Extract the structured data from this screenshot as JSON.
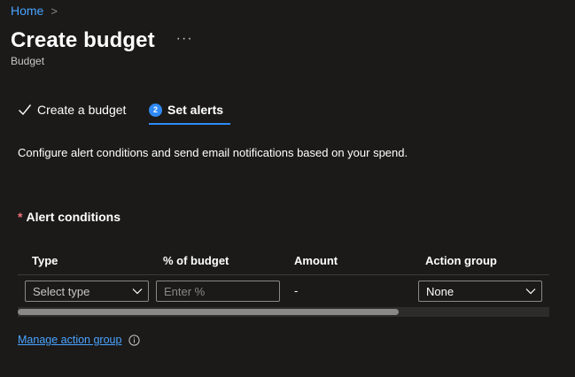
{
  "breadcrumb": {
    "home": "Home",
    "separator": ">"
  },
  "header": {
    "title": "Create budget",
    "more": "···",
    "subtitle": "Budget"
  },
  "steps": [
    {
      "label": "Create a budget",
      "state": "completed",
      "icon": "checkmark-icon"
    },
    {
      "label": "Set alerts",
      "number": "2",
      "state": "active"
    }
  ],
  "description": "Configure alert conditions and send email notifications based on your spend.",
  "alert_conditions": {
    "required_marker": "*",
    "title": "Alert conditions",
    "columns": [
      "Type",
      "% of budget",
      "Amount",
      "Action group"
    ],
    "row": {
      "type_placeholder": "Select type",
      "percent_placeholder": "Enter %",
      "amount": "-",
      "action_group": "None"
    },
    "scroll_position": 0
  },
  "manage_link": "Manage action group",
  "colors": {
    "background": "#1b1a19",
    "accent": "#2f8af5",
    "link": "#4aa3ff",
    "required": "#f1707b",
    "border": "#8a8886"
  }
}
